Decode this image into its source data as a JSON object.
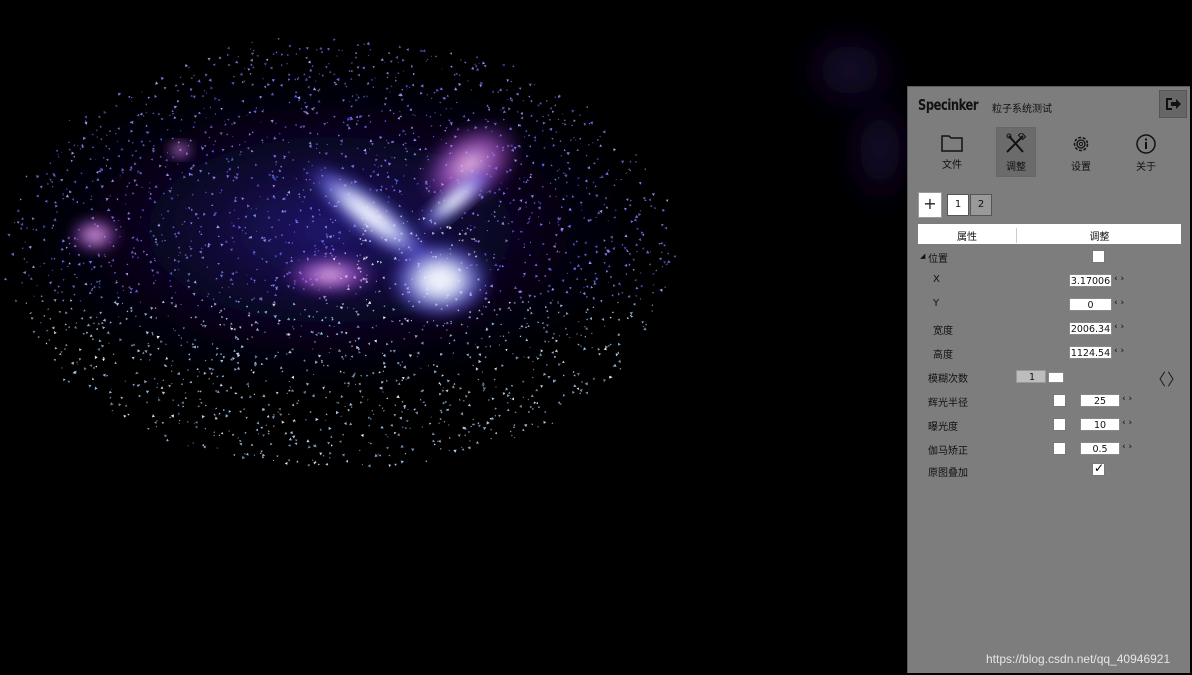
{
  "panel": {
    "brand": "Specinker",
    "subtitle": "粒子系统测试",
    "toolbar": [
      {
        "label": "文件",
        "icon": "folder-icon"
      },
      {
        "label": "调整",
        "icon": "adjust-tools-icon"
      },
      {
        "label": "设置",
        "icon": "gear-icon"
      },
      {
        "label": "关于",
        "icon": "info-icon"
      }
    ],
    "tabs": {
      "add": "+",
      "items": [
        "1",
        "2"
      ]
    },
    "table_header": {
      "col1": "属性",
      "col2": "调整"
    },
    "position_group": {
      "label": "位置",
      "x_label": "X",
      "x_value": "3.17006",
      "y_label": "Y",
      "y_value": "0",
      "w_label": "宽度",
      "w_value": "2006.34",
      "h_label": "高度",
      "h_value": "1124.54"
    },
    "blur_count": {
      "label": "模糊次数",
      "value": "1"
    },
    "glow_radius": {
      "label": "辉光半径",
      "value": "25"
    },
    "exposure": {
      "label": "曝光度",
      "value": "10"
    },
    "gamma": {
      "label": "伽马矫正",
      "value": "0.5"
    },
    "overlay": {
      "label": "原图叠加",
      "checked": true
    },
    "spin_glyph": "‹ ›",
    "prev_arrow": "〈",
    "next_arrow": "〉"
  },
  "watermark": "https://blog.csdn.net/qq_40946921",
  "colors": {
    "panel_bg": "#7d7d7d",
    "particle_core": "#ffffff",
    "particle_blue": "#6f7bff",
    "particle_pink": "#ff7fd0"
  }
}
